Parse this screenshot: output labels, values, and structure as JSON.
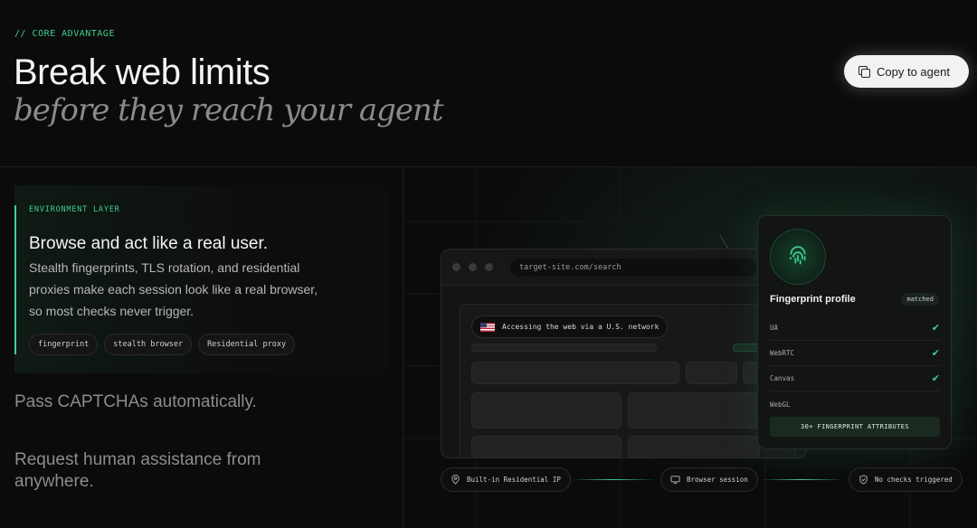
{
  "header": {
    "eyebrow": "// CORE ADVANTAGE",
    "title": "Break web limits",
    "subtitle": "before they reach your agent",
    "copy_button": "Copy to agent"
  },
  "features": {
    "active": {
      "label": "ENVIRONMENT LAYER",
      "title": "Browse and act like a real user.",
      "description": "Stealth fingerprints, TLS rotation, and residential proxies make each session look like a real browser, so most checks never trigger.",
      "tags": [
        "fingerprint",
        "stealth browser",
        "Residential proxy"
      ]
    },
    "others": [
      "Pass CAPTCHAs automatically.",
      "Request human assistance from anywhere."
    ]
  },
  "browser": {
    "url": "target-site.com/search",
    "network_pill": "Accessing the web via a U.S. network"
  },
  "fingerprint": {
    "title": "Fingerprint profile",
    "badge": "matched",
    "rows": [
      {
        "name": "UA",
        "checked": true
      },
      {
        "name": "WebRTC",
        "checked": true
      },
      {
        "name": "Canvas",
        "checked": true
      },
      {
        "name": "WebGL",
        "checked": false
      }
    ],
    "check_symbol": "✔",
    "attributes": "30+ FINGERPRINT ATTRIBUTES"
  },
  "status_bar": {
    "items": [
      {
        "label": "Built-in Residential IP",
        "icon": "location-pin-icon"
      },
      {
        "label": "Browser session",
        "icon": "monitor-icon"
      },
      {
        "label": "No checks triggered",
        "icon": "shield-check-icon"
      }
    ]
  },
  "colors": {
    "accent": "#3fcf8e",
    "background": "#0b0b0b"
  }
}
